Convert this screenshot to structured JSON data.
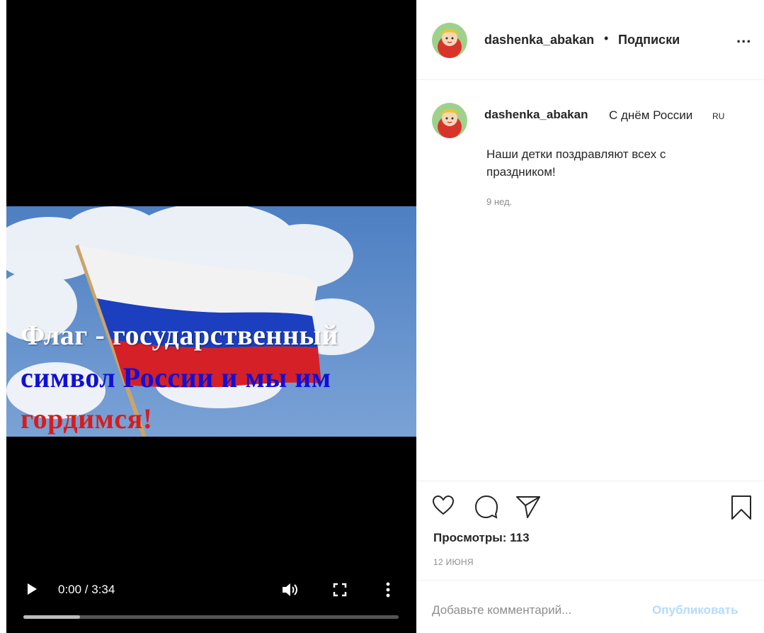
{
  "video": {
    "overlay_line1": "Флаг - государственный",
    "overlay_line2": "символ России и мы им",
    "overlay_line3": "гордимся!",
    "time": "0:00 / 3:34",
    "progress": 0.15,
    "colors": {
      "white": "#ffffff",
      "blue": "#1010d6",
      "red": "#d81c1c"
    }
  },
  "header": {
    "username": "dashenka_abakan",
    "separator": "•",
    "follow_label": "Подписки",
    "more_label": "..."
  },
  "caption": {
    "username": "dashenka_abakan",
    "title": "С днём России",
    "flag": "RU",
    "body": "Наши детки поздравляют всех с праздником!",
    "time": "9 нед."
  },
  "stats": {
    "views": "Просмотры: 113",
    "date": "12 ИЮНЯ"
  },
  "comment_box": {
    "placeholder": "Добавьте комментарий...",
    "publish_label": "Опубликовать"
  },
  "icons": [
    "play-icon",
    "volume-icon",
    "fullscreen-icon",
    "more-vertical-icon",
    "heart-icon",
    "comment-icon",
    "share-icon",
    "bookmark-icon"
  ]
}
